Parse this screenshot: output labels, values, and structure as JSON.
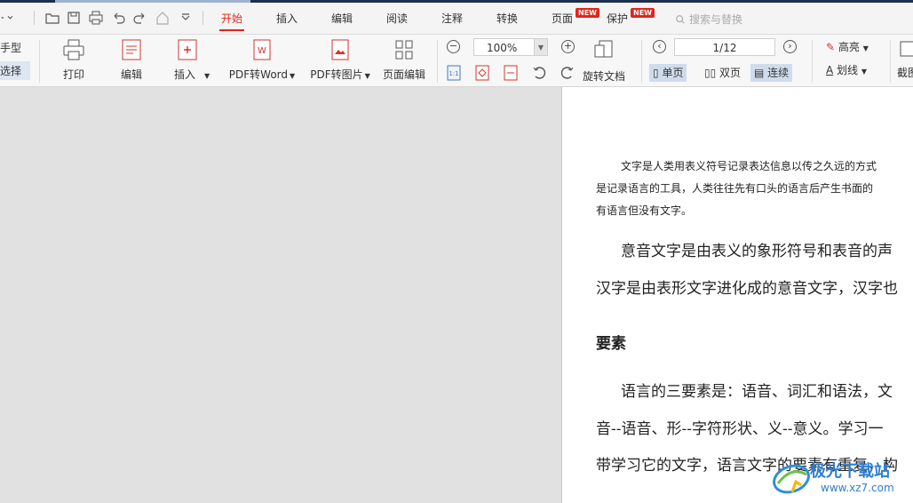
{
  "menubar": {
    "tabs": [
      {
        "label": "开始",
        "active": true
      },
      {
        "label": "插入"
      },
      {
        "label": "编辑"
      },
      {
        "label": "阅读"
      },
      {
        "label": "注释"
      },
      {
        "label": "转换"
      },
      {
        "label": "页面",
        "badge": "NEW"
      },
      {
        "label": "保护",
        "badge": "NEW"
      }
    ],
    "search_placeholder": "搜索与替换",
    "accent_color": "#e0261b"
  },
  "toolbar": {
    "hand_tool": "手型",
    "select_tool": "选择",
    "print": "打印",
    "edit": "编辑",
    "insert": "插入",
    "pdf_to_word": "PDF转Word",
    "pdf_to_image": "PDF转图片",
    "page_edit": "页面编辑",
    "zoom_value": "100%",
    "rotate_doc": "旋转文档",
    "page_indicator": "1/12",
    "single_page": "单页",
    "double_page": "双页",
    "continuous": "连续",
    "highlight": "高亮",
    "strikethrough": "划线",
    "screenshot": "截图"
  },
  "document": {
    "para1_lines": [
      "文字是人类用表义符号记录表达信息以传之久远的方式",
      "是记录语言的工具，人类往往先有口头的语言后产生书面的",
      "有语言但没有文字。"
    ],
    "para2_lines": [
      "意音文字是由表义的象形符号和表音的声",
      "汉字是由表形文字进化成的意音文字，汉字也"
    ],
    "heading": "要素",
    "para3_lines": [
      "语言的三要素是：语音、词汇和语法，文",
      "音--语音、形--字符形状、义--意义。学习一",
      "带学习它的文字，语言文字的要素有重复，构"
    ]
  },
  "watermark": {
    "text": "极光下载站",
    "url_text": "www.xz7.com"
  }
}
